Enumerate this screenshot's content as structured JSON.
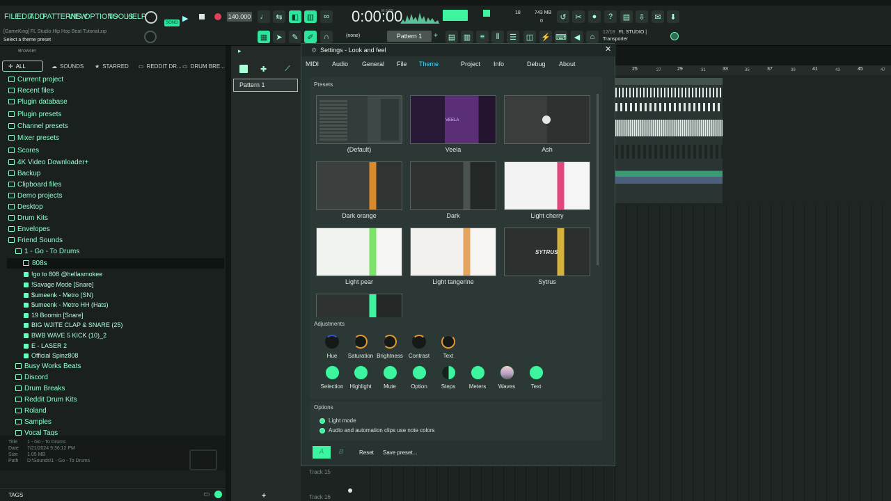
{
  "menu": [
    "FILE",
    "EDIT",
    "ADD",
    "PATTERNS",
    "VIEW",
    "OPTIONS",
    "TOOLS",
    "HELP"
  ],
  "transport": {
    "mode_label": "SONG",
    "tempo": "140.000",
    "time": "0:00:00",
    "time_units": "M:S:CS",
    "cpu_top": "18",
    "memory": "743 MB",
    "poly": "0"
  },
  "hint": {
    "project_file": "[GameKing] FL Studio Hip Hop Beat Tutorial.zip",
    "text": "Select a theme preset"
  },
  "toolbar2": {
    "none_label": "(none)",
    "pattern_selector": "Pattern 1",
    "news_counter": "12/18",
    "news_title": "FL STUDIO |",
    "news_sub": "Transporter"
  },
  "browser": {
    "title": "Browser",
    "tabs": [
      "ALL",
      "SOUNDS",
      "STARRED",
      "REDDIT DR...",
      "DRUM BRE..."
    ],
    "folders": [
      "Current project",
      "Recent files",
      "Plugin database",
      "Plugin presets",
      "Channel presets",
      "Mixer presets",
      "Scores",
      "4K Video Downloader+",
      "Backup",
      "Clipboard files",
      "Demo projects",
      "Desktop",
      "Drum Kits",
      "Envelopes",
      "Friend Sounds"
    ],
    "subfolder": "1 - Go - To Drums",
    "selected_folder": "808s",
    "files": [
      "!go to 808 @hellasmokee",
      "!Savage Mode [Snare]",
      "$umeenk - Metro (SN)",
      "$umeenk - Metro HH (Hats)",
      "19 Boomin [Snare]",
      "BIG WJITE CLAP & SNARE (25)",
      "BWB WAVE 5 KICK (10)_2",
      "E - LASER 2",
      "Official Spinz808"
    ],
    "folders2": [
      "Busy Works Beats",
      "Discord",
      "Drum Breaks",
      "Reddit Drum Kits",
      "Roland",
      "Samples",
      "Vocal Tags"
    ],
    "meta": {
      "title_label": "Title",
      "title": "1 - Go - To Drums",
      "date_label": "Date",
      "date": "7/21/2024 9:36:12 PM",
      "size_label": "Size",
      "size": "1.05 MB",
      "path_label": "Path",
      "path": "D:\\Sounds\\1 - Go - To Drums"
    },
    "tags_label": "TAGS"
  },
  "channel_rack": {
    "pattern_name": "Pattern 1"
  },
  "playlist": {
    "bar_numbers": [
      "25",
      "27",
      "29",
      "31",
      "33",
      "35",
      "37",
      "39",
      "41",
      "43",
      "45",
      "47"
    ],
    "tracks": [
      "Track 15",
      "Track 16"
    ]
  },
  "settings": {
    "title": "Settings - Look and feel",
    "tabs": [
      "MIDI",
      "Audio",
      "General",
      "File",
      "Theme",
      "Project",
      "Info",
      "Debug",
      "About"
    ],
    "active_tab": "Theme",
    "presets_label": "Presets",
    "presets": [
      "(Default)",
      "Veela",
      "Ash",
      "Dark orange",
      "Dark",
      "Light cherry",
      "Light pear",
      "Light tangerine",
      "Sytrus"
    ],
    "veela_wordmark": "VEELA",
    "sytrus_wordmark": "SYTRUS",
    "adjustments_label": "Adjustments",
    "adjustments": [
      "Hue",
      "Saturation",
      "Brightness",
      "Contrast",
      "Text"
    ],
    "colors": [
      "Selection",
      "Highlight",
      "Mute",
      "Option",
      "Steps",
      "Meters",
      "Waves",
      "Text"
    ],
    "options_label": "Options",
    "options": [
      "Light mode",
      "Audio and automation clips use note colors"
    ],
    "buttons": {
      "a": "A",
      "b": "B",
      "reset": "Reset",
      "save": "Save preset..."
    }
  },
  "colors": {
    "accent": "#3df59e",
    "tab_active": "#45d6ff",
    "background": "#131716"
  }
}
